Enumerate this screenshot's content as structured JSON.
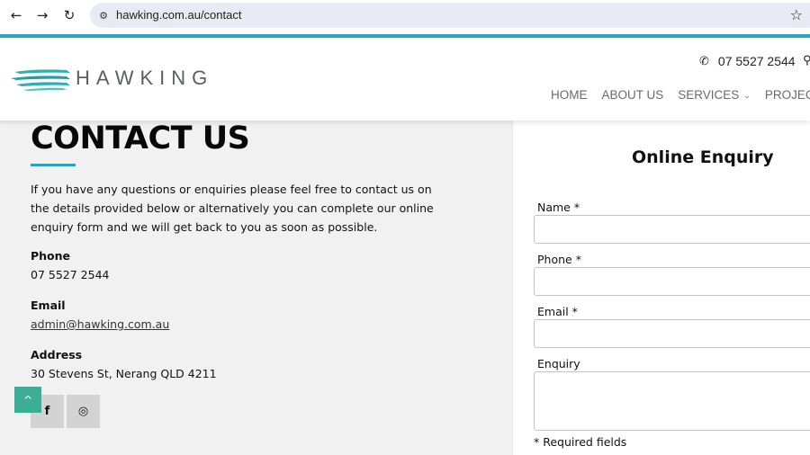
{
  "browser": {
    "back_icon": "←",
    "forward_icon": "→",
    "reload_icon": "↻",
    "site_info_icon": "⚙",
    "url": "hawking.com.au/contact",
    "bookmark_icon": "☆"
  },
  "header": {
    "logo_text": "HAWKING",
    "phone_icon": "✆",
    "phone": "07 5527 2544",
    "location_icon": "⚲",
    "nav": [
      {
        "label": "HOME"
      },
      {
        "label": "ABOUT US"
      },
      {
        "label": "SERVICES",
        "chevron": "⌄"
      },
      {
        "label": "PROJECTS & C"
      }
    ]
  },
  "contact": {
    "title": "CONTACT US",
    "intro": "If you have any questions or enquiries please feel free to contact us on the details provided below or alternatively you can complete our online enquiry form and we will get back to you as soon as possible.",
    "phone_label": "Phone",
    "phone_value": "07 5527 2544",
    "email_label": "Email",
    "email_value": "admin@hawking.com.au",
    "address_label": "Address",
    "address_value": "30 Stevens St, Nerang QLD 4211",
    "facebook_icon": "f",
    "instagram_icon": "◎",
    "back_to_top_icon": "^"
  },
  "form": {
    "title": "Online Enquiry",
    "name_label": "Name *",
    "name_value": "",
    "phone_label": "Phone *",
    "phone_value": "",
    "email_label": "Email *",
    "email_value": "",
    "enquiry_label": "Enquiry",
    "enquiry_value": "",
    "required_note": "* Required fields"
  },
  "colors": {
    "accent": "#25aac3",
    "back_to_top": "#3cae96",
    "logo_teal": "#2aa8a6"
  }
}
